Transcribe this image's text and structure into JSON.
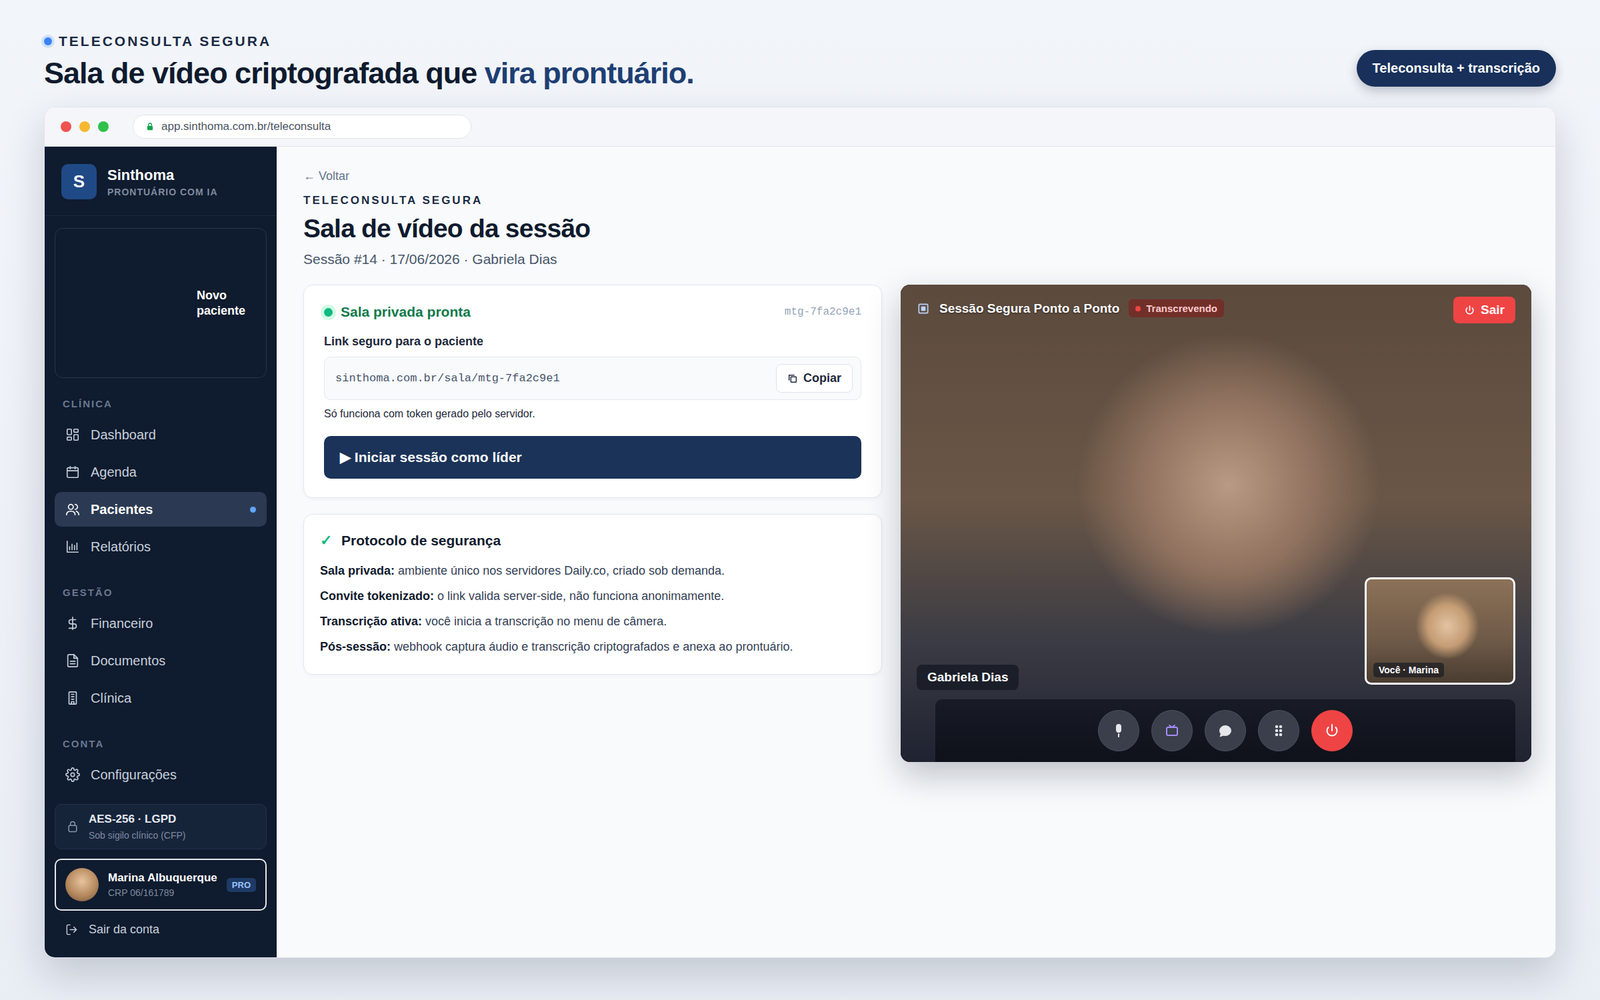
{
  "header": {
    "eyebrow": "TELECONSULTA SEGURA",
    "title": "Sala de vídeo criptografada que ",
    "title_highlight": "vira prontuário.",
    "badge": "Teleconsulta + transcrição"
  },
  "browser": {
    "url": "app.sinthoma.com.br/teleconsulta"
  },
  "sidebar": {
    "brand": {
      "logo": "S",
      "name": "Sinthoma",
      "tagline": "PRONTUÁRIO COM IA"
    },
    "new_patient": "Novo paciente",
    "sections": [
      {
        "title": "CLÍNICA",
        "items": [
          {
            "label": "Dashboard",
            "kind": "grid",
            "selected": false
          },
          {
            "label": "Agenda",
            "kind": "calendar",
            "selected": false
          },
          {
            "label": "Pacientes",
            "kind": "users",
            "selected": true
          },
          {
            "label": "Relatórios",
            "kind": "chart",
            "selected": false
          }
        ]
      },
      {
        "title": "GESTÃO",
        "items": [
          {
            "label": "Financeiro",
            "kind": "dollar",
            "selected": false
          },
          {
            "label": "Documentos",
            "kind": "doc",
            "selected": false
          },
          {
            "label": "Clínica",
            "kind": "building",
            "selected": false
          }
        ]
      },
      {
        "title": "CONTA",
        "items": [
          {
            "label": "Configurações",
            "kind": "gear",
            "selected": false
          }
        ]
      }
    ],
    "security": {
      "title": "AES-256 · LGPD",
      "subtitle": "Sob sigilo clínico (CFP)"
    },
    "user": {
      "name": "Marina Albuquerque",
      "crp": "CRP 06/161789",
      "badge": "PRO"
    },
    "logout": "Sair da conta"
  },
  "page": {
    "back": "← Voltar",
    "eyebrow": "TELECONSULTA SEGURA",
    "title": "Sala de vídeo da sessão",
    "subtitle": "Sessão #14 · 17/06/2026 · Gabriela Dias"
  },
  "room": {
    "status": "Sala privada pronta",
    "id": "mtg-7fa2c9e1",
    "link_label": "Link seguro para o paciente",
    "link": "sinthoma.com.br/sala/mtg-7fa2c9e1",
    "copy": "Copiar",
    "note": "Só funciona com token gerado pelo servidor.",
    "start": "▶ Iniciar sessão como líder"
  },
  "protocol": {
    "check": "✓",
    "title": "Protocolo de segurança",
    "items": [
      {
        "term": "Sala privada:",
        "text": "ambiente único nos servidores Daily.co, criado sob demanda."
      },
      {
        "term": "Convite tokenizado:",
        "text": "o link valida server-side, não funciona anonimamente."
      },
      {
        "term": "Transcrição ativa:",
        "text": "você inicia a transcrição no menu de câmera."
      },
      {
        "term": "Pós-sessão:",
        "text": "webhook captura áudio e transcrição criptografados e anexa ao prontuário."
      }
    ]
  },
  "video": {
    "title": "Sessão Segura Ponto a Ponto",
    "recording": "Transcrevendo",
    "leave": "Sair",
    "remote": "Gabriela Dias",
    "self": "Você · Marina",
    "controls": [
      {
        "kind": "mic"
      },
      {
        "kind": "camera"
      },
      {
        "kind": "chat"
      },
      {
        "kind": "grid"
      },
      {
        "kind": "hangup"
      }
    ]
  }
}
